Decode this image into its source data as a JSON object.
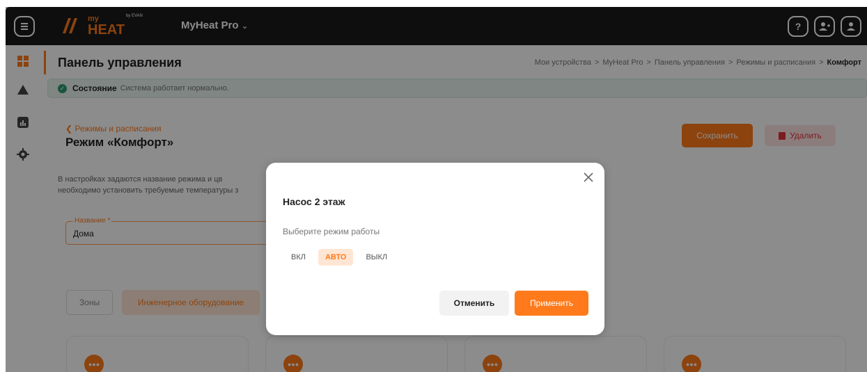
{
  "header": {
    "logo_text": "HEAT",
    "logo_top_text": "my",
    "logo_byline": "by EVAN",
    "device_name": "MyHeat Pro",
    "help_icon_text": "?"
  },
  "page": {
    "title": "Панель управления",
    "breadcrumb": [
      "Мои устройства",
      "MyHeat Pro",
      "Панель управления",
      "Режимы и расписания",
      "Комфорт"
    ],
    "breadcrumb_sep": ">"
  },
  "status": {
    "label": "Состояние",
    "text": "Система работает нормально."
  },
  "mode": {
    "back_label": "Режимы и расписания",
    "title": "Режим «Комфорт»",
    "save_label": "Сохранить",
    "delete_label": "Удалить",
    "description_line1": "В настройках задаются название режима и цв",
    "description_line2": "необходимо установить требуемые температуры з",
    "name_field_label": "Название *",
    "name_field_value": "Дома",
    "tab_zones": "Зоны",
    "tab_equipment": "Инженерное оборудование"
  },
  "modal": {
    "title": "Насос 2 этаж",
    "subtitle": "Выберите режим работы",
    "options": [
      "ВКЛ",
      "АВТО",
      "ВЫКЛ"
    ],
    "selected": "АВТО",
    "cancel_label": "Отменить",
    "apply_label": "Применить"
  },
  "colors": {
    "accent": "#ff7a1a",
    "topbar": "#1b1b1b",
    "status_green": "#2e9b6e",
    "danger": "#e0333a"
  }
}
